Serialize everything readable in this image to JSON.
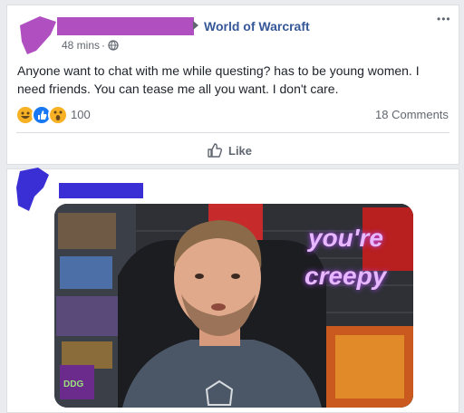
{
  "post": {
    "author_redacted": true,
    "group_name": "World of Warcraft",
    "timestamp": "48 mins",
    "separator": "·",
    "text": "Anyone want to chat with me while questing? has to be young women. I need friends. You can tease me all you want. I don't care.",
    "reaction_count": "100",
    "comments_count": "18 Comments",
    "like_label": "Like",
    "more_label": "•••"
  },
  "comment": {
    "author_redacted": true,
    "gif_caption_line1": "you're",
    "gif_caption_line2": "creepy",
    "gif_logo": "DDG"
  },
  "colors": {
    "redaction": "#b04fc0",
    "link": "#365899",
    "meta": "#616770",
    "gif_text": "#e7b8ff"
  }
}
